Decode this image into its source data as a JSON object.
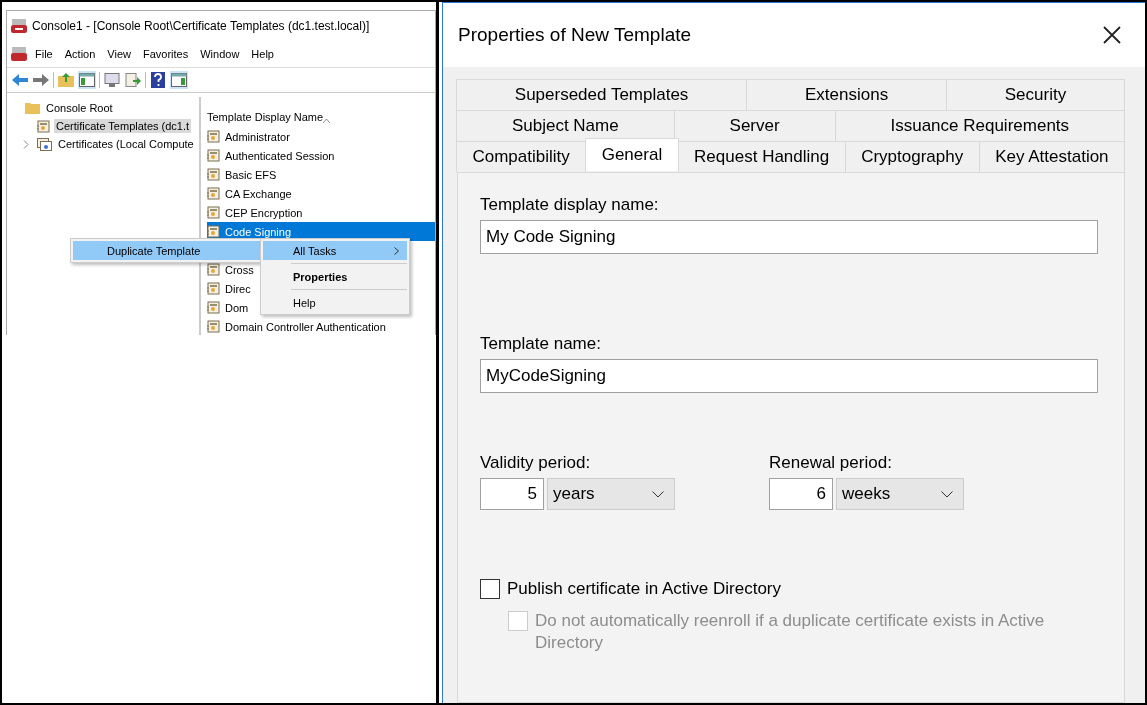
{
  "console": {
    "title": "Console1 - [Console Root\\Certificate Templates (dc1.test.local)]",
    "menu": [
      "File",
      "Action",
      "View",
      "Favorites",
      "Window",
      "Help"
    ],
    "tree": [
      {
        "label": "Console Root",
        "children": [
          {
            "label": "Certificate Templates (dc1.t",
            "selected": true
          },
          {
            "label": "Certificates (Local Compute",
            "selected": false,
            "expanded": false
          }
        ],
        "selected": false
      }
    ],
    "list": {
      "column": "Template Display Name",
      "rows": [
        {
          "label": "Administrator",
          "selected": false
        },
        {
          "label": "Authenticated Session",
          "selected": false
        },
        {
          "label": "Basic EFS",
          "selected": false
        },
        {
          "label": "CA Exchange",
          "selected": false
        },
        {
          "label": "CEP Encryption",
          "selected": false
        },
        {
          "label": "Code Signing",
          "selected": true
        },
        {
          "label": "Cross",
          "selected": false,
          "gap_before": true
        },
        {
          "label": "Direc",
          "selected": false
        },
        {
          "label": "Dom",
          "selected": false
        },
        {
          "label": "Domain Controller Authentication",
          "selected": false
        }
      ]
    },
    "context_menu": [
      {
        "kind": "submenu",
        "label": "All Tasks",
        "selected": true
      },
      {
        "kind": "default",
        "label": "Properties",
        "selected": false
      },
      {
        "kind": "item",
        "label": "Help",
        "selected": false
      }
    ],
    "submenu": [
      {
        "label": "Duplicate Template",
        "selected": true
      }
    ]
  },
  "dialog": {
    "title": "Properties of New Template",
    "tab_rows": [
      [
        {
          "label": "Superseded Templates",
          "selected": false
        },
        {
          "label": "Extensions",
          "selected": false
        },
        {
          "label": "Security",
          "selected": false
        }
      ],
      [
        {
          "label": "Subject Name",
          "selected": false
        },
        {
          "label": "Server",
          "selected": false
        },
        {
          "label": "Issuance Requirements",
          "selected": false
        }
      ],
      [
        {
          "label": "Compatibility",
          "selected": false
        },
        {
          "label": "General",
          "selected": true
        },
        {
          "label": "Request Handling",
          "selected": false
        },
        {
          "label": "Cryptography",
          "selected": false
        },
        {
          "label": "Key Attestation",
          "selected": false
        }
      ]
    ],
    "display_name": {
      "label": "Template display name:",
      "value": "My Code Signing"
    },
    "template_name": {
      "label": "Template name:",
      "value": "MyCodeSigning"
    },
    "periods": [
      {
        "label": "Validity period:",
        "value": "5",
        "unit": "years"
      },
      {
        "label": "Renewal period:",
        "value": "6",
        "unit": "weeks"
      }
    ],
    "checkboxes": [
      {
        "label": "Publish certificate in Active Directory",
        "checked": false,
        "disabled": false
      },
      {
        "label": "Do not automatically reenroll if a duplicate certificate exists in Active Directory",
        "checked": false,
        "disabled": true
      }
    ]
  }
}
